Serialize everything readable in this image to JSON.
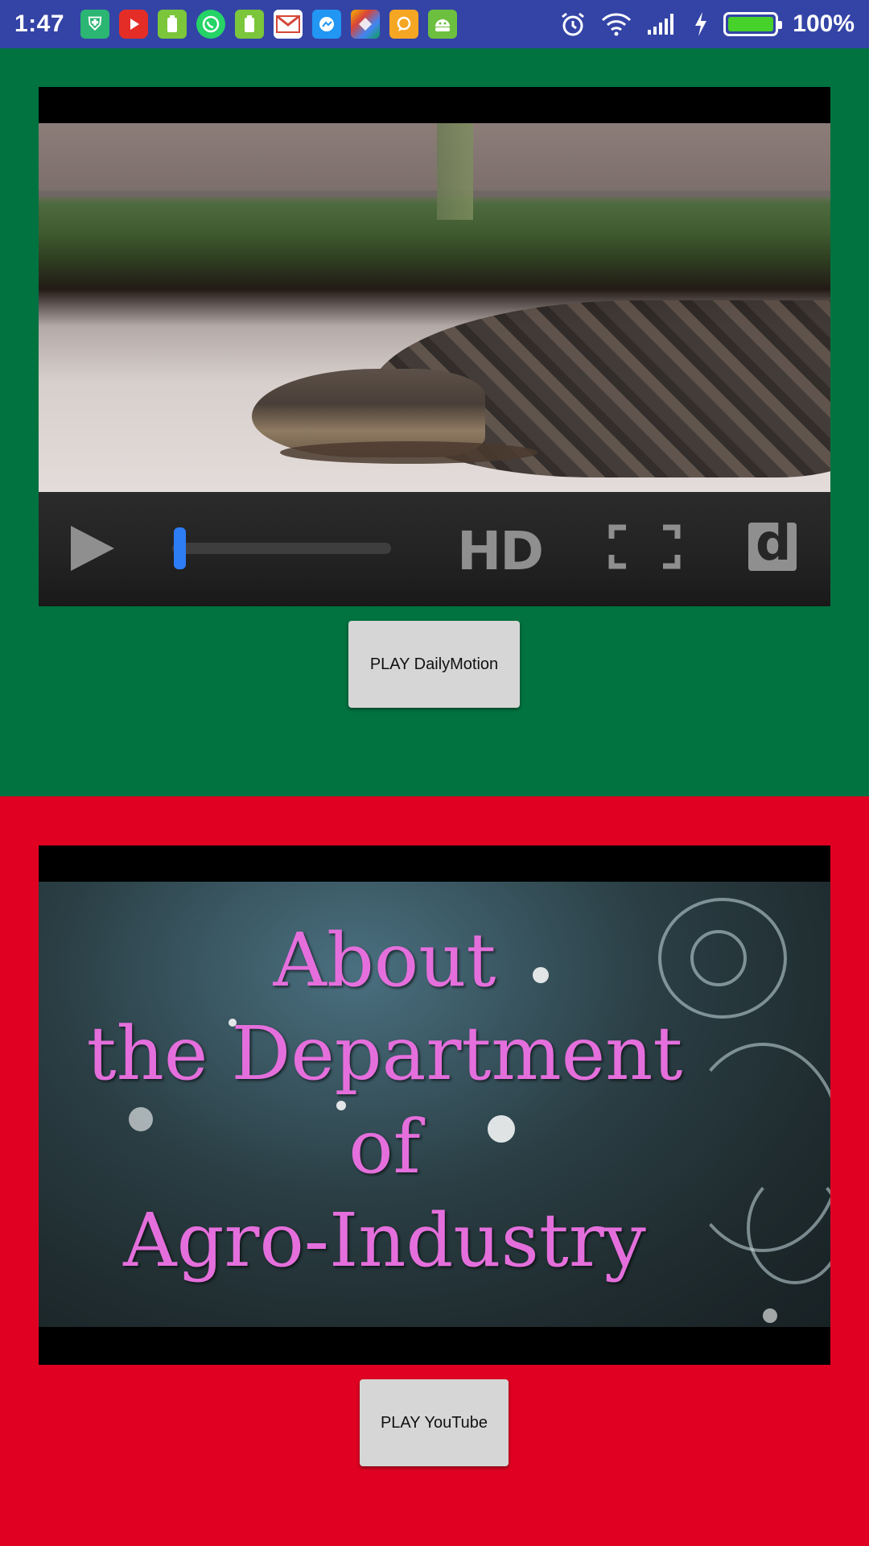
{
  "status_bar": {
    "time": "1:47",
    "battery_percent": "100%",
    "battery_level": 1.0,
    "notification_icons": [
      "shield-icon",
      "youtube-icon",
      "battery-app-icon",
      "whatsapp-icon",
      "battery-app-icon",
      "gmail-icon",
      "messenger-icon",
      "photos-icon",
      "chat-icon",
      "android-icon"
    ],
    "system_icons": [
      "alarm-icon",
      "wifi-icon",
      "signal-icon",
      "charging-icon",
      "battery-icon"
    ],
    "background_color": "#3444a6"
  },
  "dailymotion_section": {
    "background_color": "#007340",
    "player": {
      "hd_label": "HD",
      "logo_letter": "d",
      "progress": 0.02
    },
    "button_label": "PLAY DailyMotion"
  },
  "youtube_section": {
    "background_color": "#e00022",
    "video_title_lines": [
      "About",
      "the Department",
      "of",
      "Agro-Industry"
    ],
    "button_label": "PLAY YouTube"
  }
}
